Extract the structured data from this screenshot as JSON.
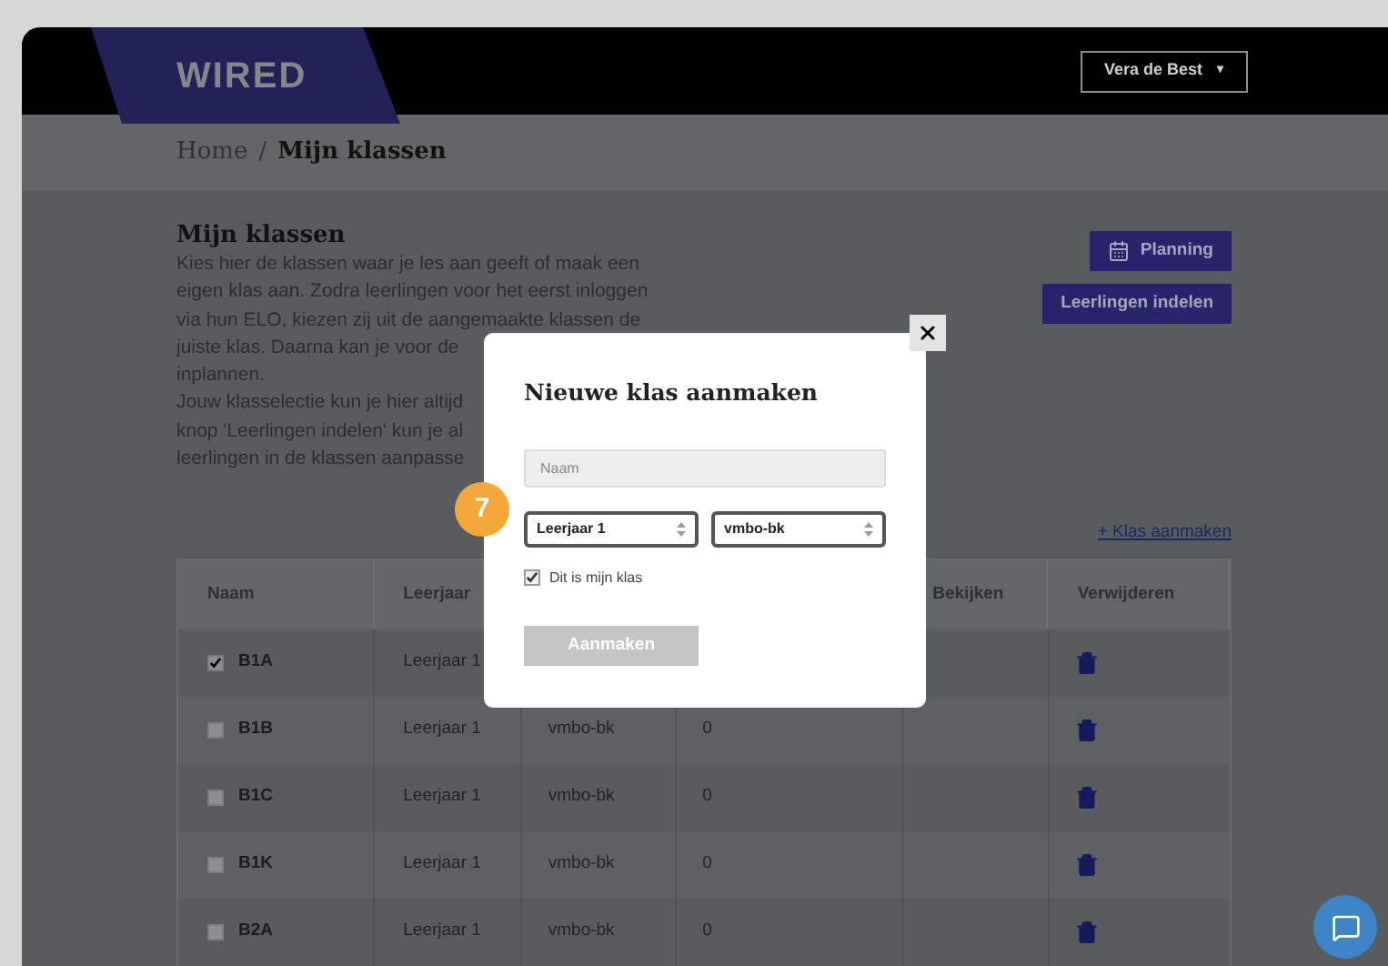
{
  "header": {
    "logo": "WIRED",
    "user_menu": {
      "label": "Vera de Best",
      "caret": "▾"
    }
  },
  "breadcrumb": {
    "separator": "/",
    "items": [
      {
        "label": "Home",
        "current": false
      },
      {
        "label": "Mijn klassen",
        "current": true
      }
    ]
  },
  "intro": {
    "title": "Mijn klassen",
    "lines": [
      "Kies hier de klassen waar je les aan geeft of maak een",
      "eigen klas aan. Zodra leerlingen voor het eerst inloggen",
      "via hun ELO, kiezen zij uit de aangemaakte klassen de",
      "juiste klas. Daarna kan je voor de",
      "inplannen.",
      "Jouw klasselectie kun je hier altijd",
      "knop 'Leerlingen indelen' kun je al",
      "leerlingen in de klassen aanpasse"
    ]
  },
  "actions": [
    {
      "label": "Planning",
      "kind": "with_icon"
    },
    {
      "label": "Leerlingen indelen",
      "kind": "text"
    }
  ],
  "add_link": "+ Klas aanmaken",
  "table": {
    "columns": [
      {
        "label": "Naam"
      },
      {
        "label": "Leerjaar"
      },
      {},
      {},
      {
        "label": "Bekijken"
      },
      {
        "label": "Verwijderen"
      }
    ],
    "rows": [
      {
        "name": "B1A",
        "checked": true,
        "column_2": "Leerjaar 1"
      },
      {
        "name": "B1B",
        "checked": false,
        "column_2": "Leerjaar 1",
        "column_3": "vmbo-bk",
        "column_4": "0"
      },
      {
        "name": "B1C",
        "checked": false,
        "column_2": "Leerjaar 1",
        "column_3": "vmbo-bk",
        "column_4": "0"
      },
      {
        "name": "B1K",
        "checked": false,
        "column_2": "Leerjaar 1",
        "column_3": "vmbo-bk",
        "column_4": "0"
      },
      {
        "name": "B2A",
        "checked": false,
        "column_2": "Leerjaar 1",
        "column_3": "vmbo-bk",
        "column_4": "0"
      }
    ]
  },
  "modal": {
    "title": "Nieuwe klas aanmaken",
    "name_field": {
      "placeholder": "Naam"
    },
    "selects": [
      {
        "value": "Leerjaar 1"
      },
      {
        "value": "vmbo-bk"
      }
    ],
    "checkbox": {
      "label": "Dit is mijn klas",
      "checked": true
    },
    "submit": {
      "label": "Aanmaken",
      "disabled": true
    }
  },
  "step_badge": "7"
}
